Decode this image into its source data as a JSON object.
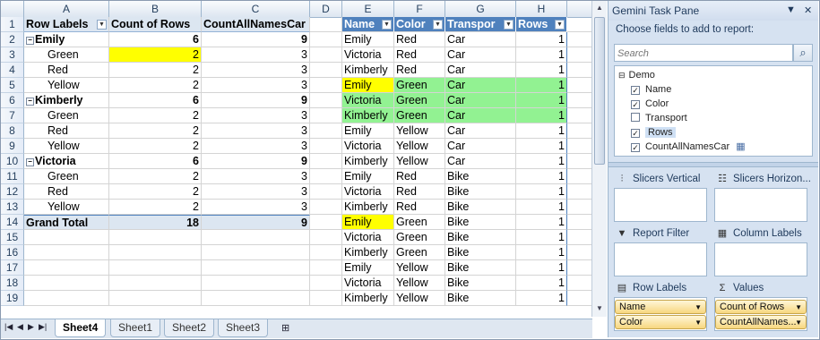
{
  "columns": [
    "A",
    "B",
    "C",
    "D",
    "E",
    "F",
    "G",
    "H"
  ],
  "rows": [
    "1",
    "2",
    "3",
    "4",
    "5",
    "6",
    "7",
    "8",
    "9",
    "10",
    "11",
    "12",
    "13",
    "14",
    "15",
    "16",
    "17",
    "18",
    "19"
  ],
  "pivot": {
    "header": [
      "Row Labels",
      "Count of Rows",
      "CountAllNamesCar"
    ],
    "rows": [
      {
        "label": "Emily",
        "count": "6",
        "names": "9",
        "level": "group"
      },
      {
        "label": "Green",
        "count": "2",
        "names": "3",
        "level": "item",
        "highlight": "yellow"
      },
      {
        "label": "Red",
        "count": "2",
        "names": "3",
        "level": "item"
      },
      {
        "label": "Yellow",
        "count": "2",
        "names": "3",
        "level": "item"
      },
      {
        "label": "Kimberly",
        "count": "6",
        "names": "9",
        "level": "group"
      },
      {
        "label": "Green",
        "count": "2",
        "names": "3",
        "level": "item"
      },
      {
        "label": "Red",
        "count": "2",
        "names": "3",
        "level": "item"
      },
      {
        "label": "Yellow",
        "count": "2",
        "names": "3",
        "level": "item"
      },
      {
        "label": "Victoria",
        "count": "6",
        "names": "9",
        "level": "group"
      },
      {
        "label": "Green",
        "count": "2",
        "names": "3",
        "level": "item"
      },
      {
        "label": "Red",
        "count": "2",
        "names": "3",
        "level": "item"
      },
      {
        "label": "Yellow",
        "count": "2",
        "names": "3",
        "level": "item"
      },
      {
        "label": "Grand Total",
        "count": "18",
        "names": "9",
        "level": "total"
      }
    ]
  },
  "table": {
    "header": [
      "Name",
      "Color",
      "Transpor",
      "Rows"
    ],
    "rows": [
      [
        "Emily",
        "Red",
        "Car",
        "1",
        ""
      ],
      [
        "Victoria",
        "Red",
        "Car",
        "1",
        ""
      ],
      [
        "Kimberly",
        "Red",
        "Car",
        "1",
        ""
      ],
      [
        "Emily",
        "Green",
        "Car",
        "1",
        "greenrow-yellowname"
      ],
      [
        "Victoria",
        "Green",
        "Car",
        "1",
        "greenrow"
      ],
      [
        "Kimberly",
        "Green",
        "Car",
        "1",
        "greenrow"
      ],
      [
        "Emily",
        "Yellow",
        "Car",
        "1",
        ""
      ],
      [
        "Victoria",
        "Yellow",
        "Car",
        "1",
        ""
      ],
      [
        "Kimberly",
        "Yellow",
        "Car",
        "1",
        ""
      ],
      [
        "Emily",
        "Red",
        "Bike",
        "1",
        ""
      ],
      [
        "Victoria",
        "Red",
        "Bike",
        "1",
        ""
      ],
      [
        "Kimberly",
        "Red",
        "Bike",
        "1",
        ""
      ],
      [
        "Emily",
        "Green",
        "Bike",
        "1",
        "yellowname"
      ],
      [
        "Victoria",
        "Green",
        "Bike",
        "1",
        ""
      ],
      [
        "Kimberly",
        "Green",
        "Bike",
        "1",
        ""
      ],
      [
        "Emily",
        "Yellow",
        "Bike",
        "1",
        ""
      ],
      [
        "Victoria",
        "Yellow",
        "Bike",
        "1",
        ""
      ],
      [
        "Kimberly",
        "Yellow",
        "Bike",
        "1",
        ""
      ]
    ]
  },
  "sheet_tabs": [
    "Sheet4",
    "Sheet1",
    "Sheet2",
    "Sheet3"
  ],
  "active_tab": "Sheet4",
  "pane": {
    "title": "Gemini Task Pane",
    "subtitle": "Choose fields to add to report:",
    "search_placeholder": "Search",
    "root": "Demo",
    "fields": [
      {
        "name": "Name",
        "checked": true
      },
      {
        "name": "Color",
        "checked": true
      },
      {
        "name": "Transport",
        "checked": false
      },
      {
        "name": "Rows",
        "checked": true
      },
      {
        "name": "CountAllNamesCar",
        "checked": true
      }
    ],
    "zones": {
      "slicers_vertical": "Slicers Vertical",
      "slicers_horizontal": "Slicers Horizon...",
      "report_filter": "Report Filter",
      "column_labels": "Column Labels",
      "row_labels": "Row Labels",
      "values": "Values"
    },
    "row_label_chips": [
      "Name",
      "Color"
    ],
    "value_chips": [
      "Count of Rows",
      "CountAllNames..."
    ]
  },
  "colors": {
    "accent": "#4f81bd",
    "highlight_yellow": "#ffff00",
    "highlight_green": "#92f292"
  }
}
